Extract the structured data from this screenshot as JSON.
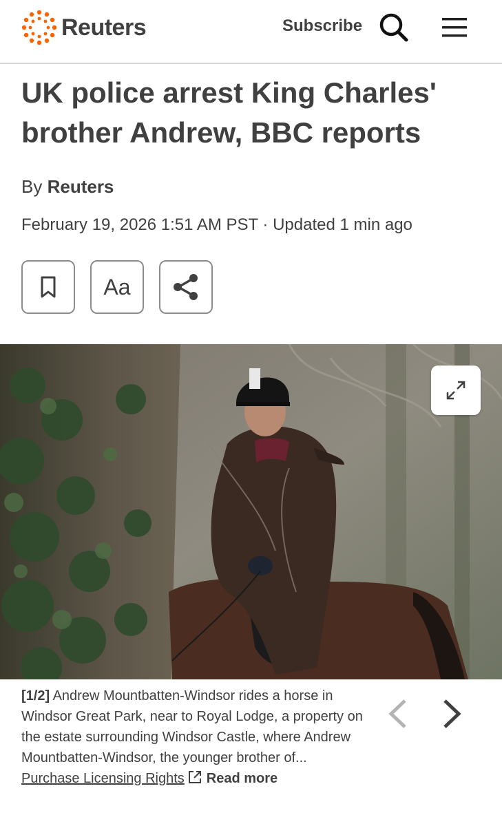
{
  "header": {
    "logo_text": "Reuters",
    "subscribe_label": "Subscribe",
    "search_icon": "search-icon",
    "menu_icon": "hamburger-menu-icon"
  },
  "article": {
    "headline": "UK police arrest King Charles' brother Andrew, BBC reports",
    "byline_prefix": "By",
    "byline_author": "Reuters",
    "dateline": "February 19, 2026 1:51 AM PST · Updated 1 min ago",
    "tools": {
      "bookmark_icon": "bookmark-icon",
      "font_label": "Aa",
      "share_icon": "share-icon"
    }
  },
  "gallery": {
    "expand_icon": "expand-icon",
    "counter": "[1/2]",
    "caption": "Andrew Mountbatten-Windsor rides a horse in Windsor Great Park, near to Royal Lodge, a property on the estate surrounding Windsor Castle, where Andrew Mountbatten-Windsor, the younger brother of...",
    "licensing_link": "Purchase Licensing Rights",
    "read_more": "Read more",
    "prev_icon": "chevron-left-icon",
    "next_icon": "chevron-right-icon"
  },
  "colors": {
    "brand_orange": "#fa6400",
    "text": "#404040",
    "border": "#8c8c8c"
  }
}
